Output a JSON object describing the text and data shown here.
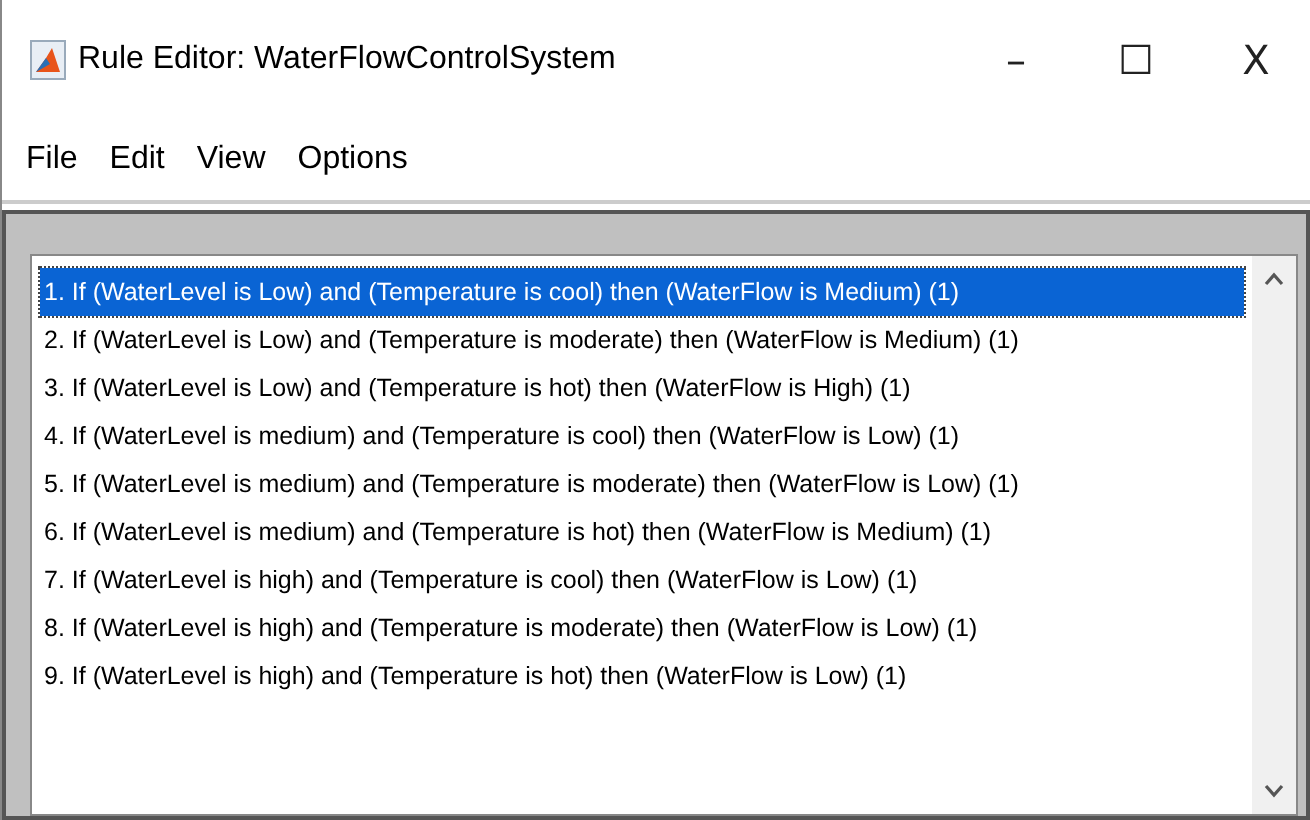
{
  "window": {
    "title": "Rule Editor: WaterFlowControlSystem",
    "controls": [
      "–",
      "☐",
      "X"
    ]
  },
  "menu": [
    "File",
    "Edit",
    "View",
    "Options"
  ],
  "rules": [
    {
      "text": "1. If (WaterLevel is Low) and (Temperature is cool) then (WaterFlow is Medium) (1)",
      "selected": true
    },
    {
      "text": "2. If (WaterLevel is Low) and (Temperature is moderate) then (WaterFlow is Medium) (1)",
      "selected": false
    },
    {
      "text": "3. If (WaterLevel is Low) and (Temperature is hot) then (WaterFlow is High) (1)",
      "selected": false
    },
    {
      "text": "4. If (WaterLevel is medium) and (Temperature is cool) then (WaterFlow is Low) (1)",
      "selected": false
    },
    {
      "text": "5. If (WaterLevel is medium) and (Temperature is moderate) then (WaterFlow is Low) (1)",
      "selected": false
    },
    {
      "text": "6. If (WaterLevel is medium) and (Temperature is hot) then (WaterFlow is Medium) (1)",
      "selected": false
    },
    {
      "text": "7. If (WaterLevel is high) and (Temperature is cool) then (WaterFlow is Low) (1)",
      "selected": false
    },
    {
      "text": "8. If (WaterLevel is high) and (Temperature is moderate) then (WaterFlow is Low) (1)",
      "selected": false
    },
    {
      "text": "9. If (WaterLevel is high) and (Temperature is hot) then (WaterFlow is Low) (1)",
      "selected": false
    }
  ]
}
